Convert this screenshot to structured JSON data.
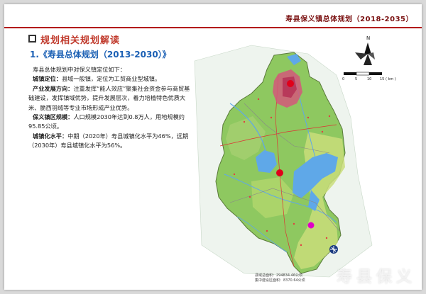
{
  "header": {
    "title": "寿县保义镇总体规划（2018-2035）"
  },
  "section": {
    "title": "规划相关规划解读"
  },
  "subsection": {
    "title": "1.《寿县总体规划（2013-2030）》"
  },
  "body": {
    "intro": "寿县总体规划中对保义镇定位如下：",
    "p1_label": "城镇定位：",
    "p1_text": "县域一般镇，定位为工贸商业型城镇。",
    "p2_label": "产业发展方向：",
    "p2_text": "注重发挥“能人效应”聚集社会资金参与商贸基础建设，发挥镇域优势，提升发展层次，着力培植特色优质大米、脆西羽绒等专业市场形成产业优势。",
    "p3_label": "保义镇区规模：",
    "p3_text": "人口规模2030年达到0.8万人，用地规模约95.85公顷。",
    "p4_label": "城镇化水平：",
    "p4_text": "中期（2020年）寿县城镇化水平为46%，远期（2030年）寿县城镇化水平为56%。"
  },
  "map": {
    "north_label": "N",
    "scale_ticks": [
      "0",
      "5",
      "10",
      "15 ( km )"
    ],
    "footer_line1": "县域总面积：294834.46公顷",
    "footer_line2": "集中建设区面积：8370.64公顷",
    "colors": {
      "land": "#8ec860",
      "water": "#5fa8e8",
      "urban": "#d4587a",
      "town_marker": "#e0001a",
      "baoyi_marker": "#e000c8"
    }
  },
  "watermark": {
    "text": "寿县保义"
  }
}
